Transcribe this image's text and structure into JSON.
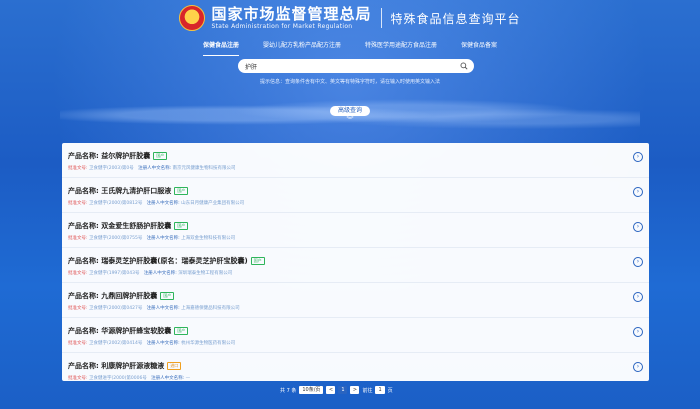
{
  "header": {
    "title_cn": "国家市场监督管理总局",
    "title_en": "State Administration  for  Market Regulation",
    "platform": "特殊食品信息查询平台"
  },
  "tabs": [
    {
      "label": "保健食品注册",
      "active": true
    },
    {
      "label": "婴幼儿配方乳粉产品配方注册",
      "active": false
    },
    {
      "label": "特殊医学用途配方食品注册",
      "active": false
    },
    {
      "label": "保健食品备案",
      "active": false
    }
  ],
  "search": {
    "value": "护肝",
    "placeholder": ""
  },
  "hint": "提示信息：查询条件含有中文、英文等有特殊字符时，请在输入时使用英文输入法",
  "advanced": {
    "label": "高级查询"
  },
  "results": [
    {
      "name": "益尔牌护肝胶囊",
      "badge": "国产",
      "badge_type": "dom",
      "approval": "卫食健字(2003)第0号",
      "company": "南京元风健康生物科技有限公司"
    },
    {
      "name": "王氏牌九清护肝口服液",
      "badge": "国产",
      "badge_type": "dom",
      "approval": "卫食健字(2000)第0812号",
      "company": "山东日月健康产业集团有限公司"
    },
    {
      "name": "双金爱生舒肠护肝胶囊",
      "badge": "国产",
      "badge_type": "dom",
      "approval": "卫食健字(2000)第0755号",
      "company": "上海双金生物科技有限公司"
    },
    {
      "name": "瑞泰灵芝护肝胶囊(原名：瑞泰灵芝护肝宝胶囊)",
      "badge": "国产",
      "badge_type": "dom",
      "approval": "卫食健字(1997)第043号",
      "company": "深圳瑞泰生物工程有限公司"
    },
    {
      "name": "九鼎回牌护肝胶囊",
      "badge": "国产",
      "badge_type": "dom",
      "approval": "卫食健字(2000)第0427号",
      "company": "上海嘉德保健品科技有限公司"
    },
    {
      "name": "华源牌护肝蜂宝软胶囊",
      "badge": "国产",
      "badge_type": "dom",
      "approval": "卫食健字(2002)第0414号",
      "company": "杭州华源生物医药有限公司"
    },
    {
      "name": "利康牌护肝源液糖液",
      "badge": "进口",
      "badge_type": "imp",
      "approval": "卫食健进字(2000)第0006号",
      "company": "—"
    }
  ],
  "labels": {
    "product_name": "产品名称: ",
    "approval_no": "批准文号: ",
    "registrant": "注册人中文名称: "
  },
  "pager": {
    "total": "共 7 条",
    "page_size": "10条/页",
    "prev": "<",
    "current": "1",
    "next": ">",
    "goto_label": "前往",
    "goto_value": "1",
    "page_unit": "页"
  },
  "colors": {
    "brand_blue": "#2a64c0",
    "domestic_badge": "#2fb55b",
    "import_badge": "#f0a020"
  }
}
